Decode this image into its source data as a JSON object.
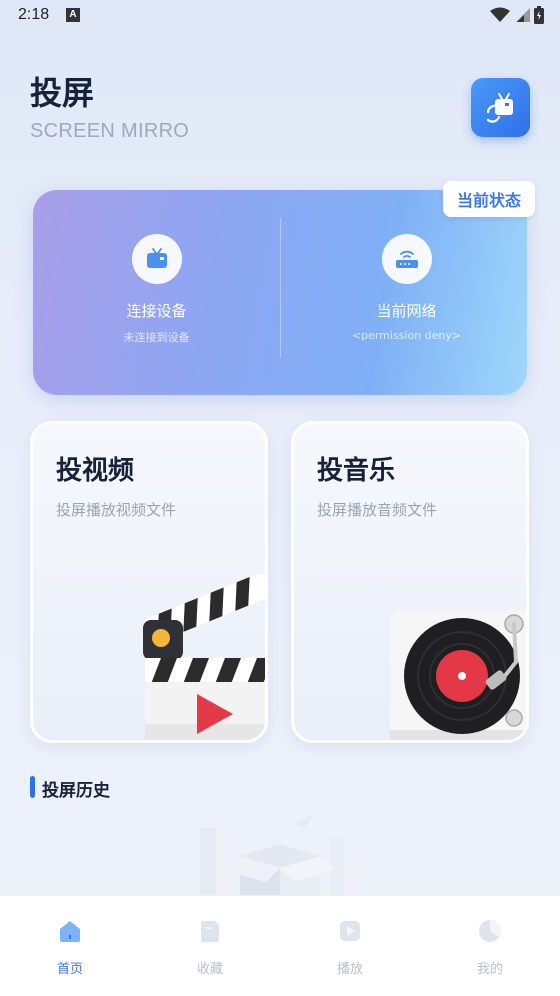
{
  "status_bar": {
    "time": "2:18",
    "notification_letter": "A"
  },
  "header": {
    "title": "投屏",
    "subtitle": "SCREEN MIRRO"
  },
  "status_card": {
    "badge": "当前状态",
    "device": {
      "label": "连接设备",
      "status": "未连接到设备",
      "icon": "tv-icon"
    },
    "network": {
      "label": "当前网络",
      "status": "<permission deny>",
      "icon": "router-icon"
    }
  },
  "features": [
    {
      "title": "投视频",
      "subtitle": "投屏播放视频文件",
      "icon": "clapperboard-icon"
    },
    {
      "title": "投音乐",
      "subtitle": "投屏播放音频文件",
      "icon": "turntable-icon"
    }
  ],
  "history": {
    "title": "投屏历史"
  },
  "bottom_nav": [
    {
      "label": "首页",
      "icon": "home-icon",
      "active": true
    },
    {
      "label": "收藏",
      "icon": "favorites-icon",
      "active": false
    },
    {
      "label": "播放",
      "icon": "play-icon",
      "active": false
    },
    {
      "label": "我的",
      "icon": "profile-icon",
      "active": false
    }
  ],
  "colors": {
    "accent": "#3b7be8",
    "card_gradient_start": "#a99ee9",
    "card_gradient_end": "#9fd7fb"
  }
}
